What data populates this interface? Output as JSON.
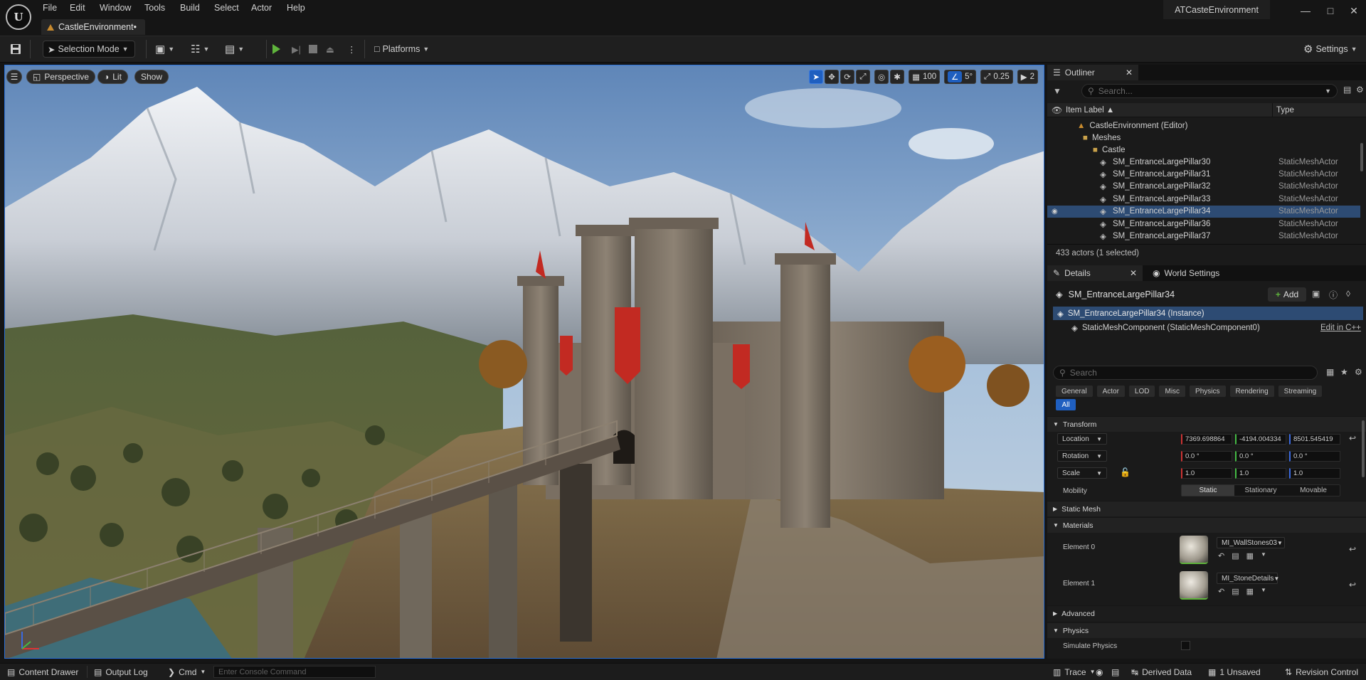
{
  "menu": [
    "File",
    "Edit",
    "Window",
    "Tools",
    "Build",
    "Select",
    "Actor",
    "Help"
  ],
  "document_tab": "CastleEnvironment•",
  "project_name": "ATCasteEnvironment",
  "toolbar": {
    "selection_mode": "Selection Mode",
    "platforms": "Platforms",
    "settings": "Settings"
  },
  "viewport": {
    "perspective": "Perspective",
    "lit": "Lit",
    "show": "Show",
    "grid_size": "100",
    "rotation_snap": "5°",
    "scale_snap": "0.25",
    "camera_speed": "2"
  },
  "outliner": {
    "tab": "Outliner",
    "search_placeholder": "Search...",
    "col_label": "Item Label ▲",
    "col_type": "Type",
    "root": "CastleEnvironment (Editor)",
    "folder_meshes": "Meshes",
    "folder_castle": "Castle",
    "items": [
      {
        "label": "SM_EntranceLargePillar30",
        "type": "StaticMeshActor"
      },
      {
        "label": "SM_EntranceLargePillar31",
        "type": "StaticMeshActor"
      },
      {
        "label": "SM_EntranceLargePillar32",
        "type": "StaticMeshActor"
      },
      {
        "label": "SM_EntranceLargePillar33",
        "type": "StaticMeshActor"
      },
      {
        "label": "SM_EntranceLargePillar34",
        "type": "StaticMeshActor"
      },
      {
        "label": "SM_EntranceLargePillar36",
        "type": "StaticMeshActor"
      },
      {
        "label": "SM_EntranceLargePillar37",
        "type": "StaticMeshActor"
      }
    ],
    "selected_index": 4,
    "status": "433 actors (1 selected)"
  },
  "details": {
    "tab": "Details",
    "world_settings_tab": "World Settings",
    "actor_name": "SM_EntranceLargePillar34",
    "add_label": "Add",
    "instance_row": "SM_EntranceLargePillar34 (Instance)",
    "component_row": "StaticMeshComponent (StaticMeshComponent0)",
    "edit_cpp": "Edit in C++",
    "search_placeholder": "Search",
    "categories": [
      "General",
      "Actor",
      "LOD",
      "Misc",
      "Physics",
      "Rendering",
      "Streaming"
    ],
    "all_label": "All",
    "transform_header": "Transform",
    "location_label": "Location",
    "location": [
      "7369.698864",
      "-4194.004334",
      "8501.545419"
    ],
    "rotation_label": "Rotation",
    "rotation": [
      "0.0 °",
      "0.0 °",
      "0.0 °"
    ],
    "scale_label": "Scale",
    "scale": [
      "1.0",
      "1.0",
      "1.0"
    ],
    "mobility_label": "Mobility",
    "mobility_options": [
      "Static",
      "Stationary",
      "Movable"
    ],
    "static_mesh_header": "Static Mesh",
    "materials_header": "Materials",
    "element0_label": "Element 0",
    "element0_material": "MI_WallStones03",
    "element1_label": "Element 1",
    "element1_material": "MI_StoneDetails",
    "advanced_header": "Advanced",
    "physics_header": "Physics",
    "simulate_physics": "Simulate Physics"
  },
  "statusbar": {
    "content_drawer": "Content Drawer",
    "output_log": "Output Log",
    "cmd": "Cmd",
    "console_placeholder": "Enter Console Command",
    "trace": "Trace",
    "derived_data": "Derived Data",
    "unsaved": "1 Unsaved",
    "revision_control": "Revision Control"
  },
  "colors": {
    "accent_blue": "#1f5fc0",
    "play_green": "#5fb43c",
    "selection_row": "#2d4b73",
    "banner_red": "#c22a22"
  }
}
